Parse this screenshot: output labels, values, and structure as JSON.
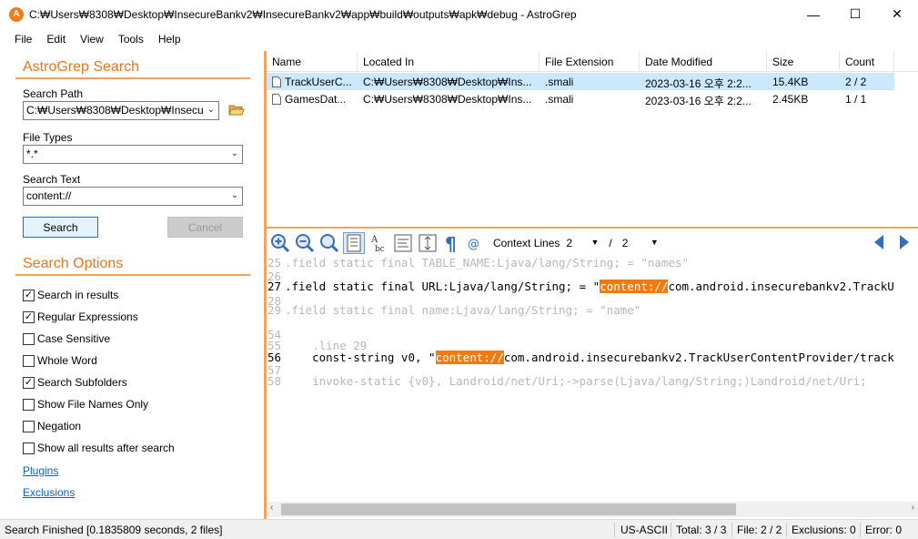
{
  "window": {
    "title": "C:₩Users₩8308₩Desktop₩InsecureBankv2₩InsecureBankv2₩app₩build₩outputs₩apk₩debug - AstroGrep",
    "app_icon": "astrogrep-icon",
    "minimize": "—",
    "maximize": "☐",
    "close": "✕"
  },
  "menu": [
    "File",
    "Edit",
    "View",
    "Tools",
    "Help"
  ],
  "search_panel": {
    "title": "AstroGrep Search",
    "path_label": "Search Path",
    "path_value": "C:₩Users₩8308₩Desktop₩Insecu",
    "types_label": "File Types",
    "types_value": "*.*",
    "text_label": "Search Text",
    "text_value": "content://",
    "search_button": "Search",
    "cancel_button": "Cancel"
  },
  "options": {
    "title": "Search Options",
    "items": [
      {
        "label": "Search in results",
        "checked": true
      },
      {
        "label": "Regular Expressions",
        "checked": true
      },
      {
        "label": "Case Sensitive",
        "checked": false
      },
      {
        "label": "Whole Word",
        "checked": false
      },
      {
        "label": "Search Subfolders",
        "checked": true
      },
      {
        "label": "Show File Names Only",
        "checked": false
      },
      {
        "label": "Negation",
        "checked": false
      },
      {
        "label": "Show all results after search",
        "checked": false
      }
    ],
    "plugins_link": "Plugins",
    "exclusions_link": "Exclusions"
  },
  "results": {
    "columns": [
      "Name",
      "Located In",
      "File Extension",
      "Date Modified",
      "Size",
      "Count"
    ],
    "rows": [
      {
        "name": "TrackUserC...",
        "located": "C:₩Users₩8308₩Desktop₩Ins...",
        "ext": ".smali",
        "date": "2023-03-16 오후 2:2...",
        "size": "15.4KB",
        "count": "2 / 2"
      },
      {
        "name": "GamesDat...",
        "located": "C:₩Users₩8308₩Desktop₩Ins...",
        "ext": ".smali",
        "date": "2023-03-16 오후 2:2...",
        "size": "2.45KB",
        "count": "1 / 1"
      }
    ]
  },
  "toolbar": {
    "context_label": "Context Lines",
    "context_before": "2",
    "separator": "/",
    "context_after": "2"
  },
  "code": {
    "lines": [
      {
        "num": "25",
        "pre": ".field static final TABLE_NAME:Ljava/lang/String; = \"names\"",
        "match": "",
        "post": "",
        "context": true
      },
      {
        "num": "26",
        "pre": "",
        "match": "",
        "post": "",
        "context": true
      },
      {
        "num": "27",
        "pre": ".field static final URL:Ljava/lang/String; = \"",
        "match": "content://",
        "post": "com.android.insecurebankv2.TrackU",
        "context": false
      },
      {
        "num": "28",
        "pre": "",
        "match": "",
        "post": "",
        "context": true
      },
      {
        "num": "29",
        "pre": ".field static final name:Ljava/lang/String; = \"name\"",
        "match": "",
        "post": "",
        "context": true
      },
      {
        "num": "54",
        "pre": "",
        "match": "",
        "post": "",
        "context": true
      },
      {
        "num": "55",
        "pre": "    .line 29",
        "match": "",
        "post": "",
        "context": true
      },
      {
        "num": "56",
        "pre": "    const-string v0, \"",
        "match": "content://",
        "post": "com.android.insecurebankv2.TrackUserContentProvider/track",
        "context": false
      },
      {
        "num": "57",
        "pre": "",
        "match": "",
        "post": "",
        "context": true
      },
      {
        "num": "58",
        "pre": "    invoke-static {v0}, Landroid/net/Uri;->parse(Ljava/lang/String;)Landroid/net/Uri;",
        "match": "",
        "post": "",
        "context": true
      }
    ]
  },
  "status": {
    "message": "Search Finished [0.1835809 seconds, 2 files]",
    "encoding": "US-ASCII",
    "total": "Total: 3 / 3",
    "file": "File: 2 / 2",
    "exclusions": "Exclusions: 0",
    "error": "Error: 0"
  },
  "colors": {
    "accent": "#e8761c",
    "selected_row": "#cce8ff",
    "highlight": "#f47a0e"
  }
}
